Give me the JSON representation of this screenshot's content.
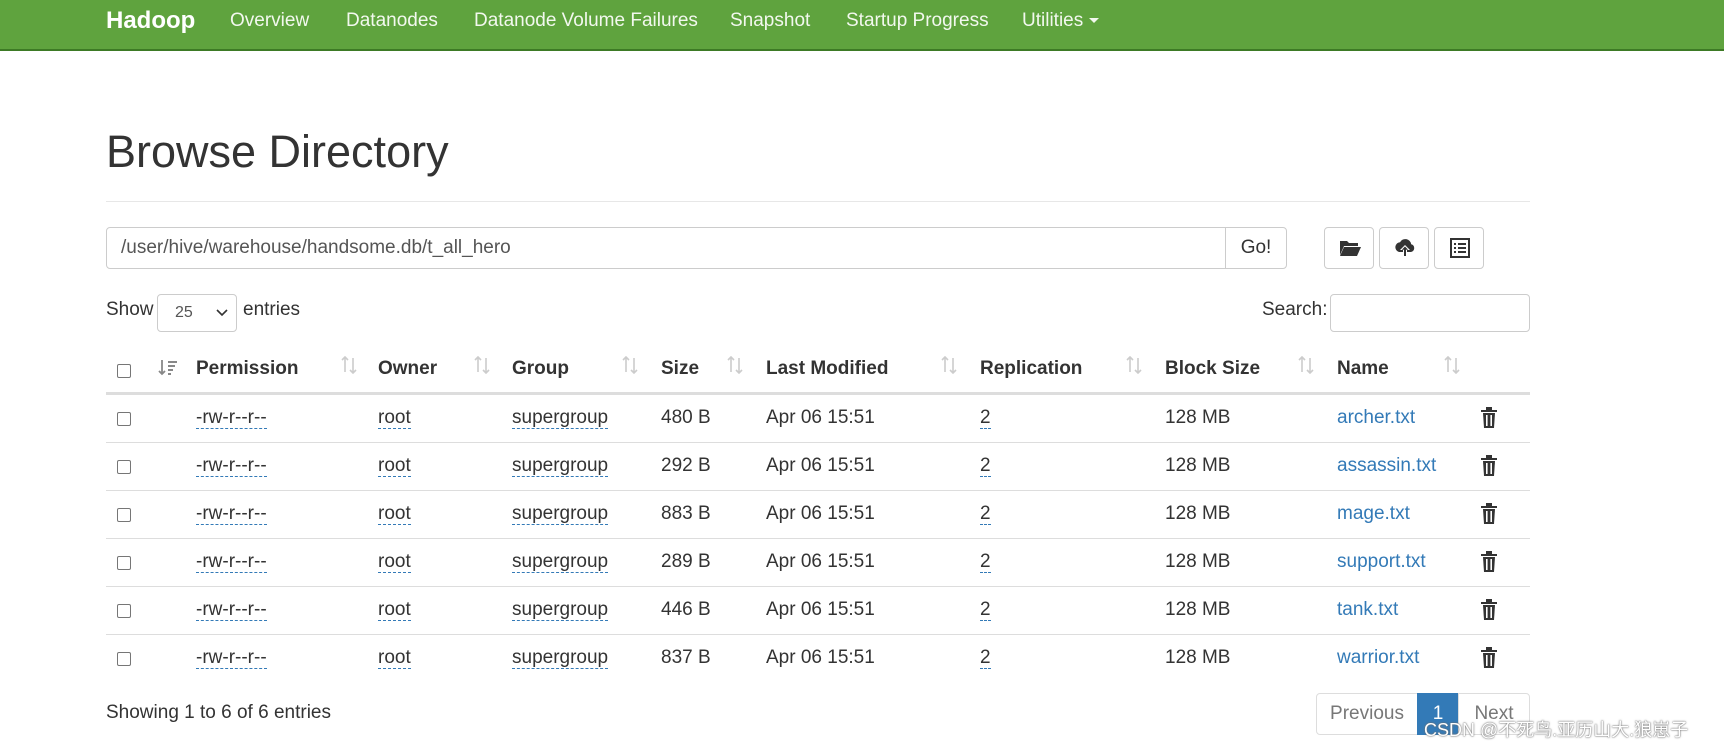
{
  "navbar": {
    "brand": "Hadoop",
    "items": [
      {
        "label": "Overview"
      },
      {
        "label": "Datanodes"
      },
      {
        "label": "Datanode Volume Failures"
      },
      {
        "label": "Snapshot"
      },
      {
        "label": "Startup Progress"
      },
      {
        "label": "Utilities"
      }
    ]
  },
  "page": {
    "title": "Browse Directory"
  },
  "path_bar": {
    "value": "/user/hive/warehouse/handsome.db/t_all_hero",
    "go_label": "Go!",
    "tools": [
      "folder-open-icon",
      "cloud-upload-icon",
      "list-alt-icon"
    ]
  },
  "table_controls": {
    "show_label": "Show",
    "page_size": "25",
    "entries_label": "entries",
    "search_label": "Search:",
    "search_value": ""
  },
  "table": {
    "columns": [
      "Permission",
      "Owner",
      "Group",
      "Size",
      "Last Modified",
      "Replication",
      "Block Size",
      "Name"
    ],
    "rows": [
      {
        "permission": "-rw-r--r--",
        "owner": "root",
        "group": "supergroup",
        "size": "480 B",
        "modified": "Apr 06 15:51",
        "replication": "2",
        "block_size": "128 MB",
        "name": "archer.txt"
      },
      {
        "permission": "-rw-r--r--",
        "owner": "root",
        "group": "supergroup",
        "size": "292 B",
        "modified": "Apr 06 15:51",
        "replication": "2",
        "block_size": "128 MB",
        "name": "assassin.txt"
      },
      {
        "permission": "-rw-r--r--",
        "owner": "root",
        "group": "supergroup",
        "size": "883 B",
        "modified": "Apr 06 15:51",
        "replication": "2",
        "block_size": "128 MB",
        "name": "mage.txt"
      },
      {
        "permission": "-rw-r--r--",
        "owner": "root",
        "group": "supergroup",
        "size": "289 B",
        "modified": "Apr 06 15:51",
        "replication": "2",
        "block_size": "128 MB",
        "name": "support.txt"
      },
      {
        "permission": "-rw-r--r--",
        "owner": "root",
        "group": "supergroup",
        "size": "446 B",
        "modified": "Apr 06 15:51",
        "replication": "2",
        "block_size": "128 MB",
        "name": "tank.txt"
      },
      {
        "permission": "-rw-r--r--",
        "owner": "root",
        "group": "supergroup",
        "size": "837 B",
        "modified": "Apr 06 15:51",
        "replication": "2",
        "block_size": "128 MB",
        "name": "warrior.txt"
      }
    ]
  },
  "footer": {
    "info": "Showing 1 to 6 of 6 entries",
    "previous_label": "Previous",
    "current_page": "1",
    "next_label": "Next",
    "watermark": "CSDN @不死鸟.亚历山大.狼崽子"
  },
  "colors": {
    "navbar": "#5fa33e",
    "link": "#337ab7",
    "active_page": "#337ab7"
  }
}
